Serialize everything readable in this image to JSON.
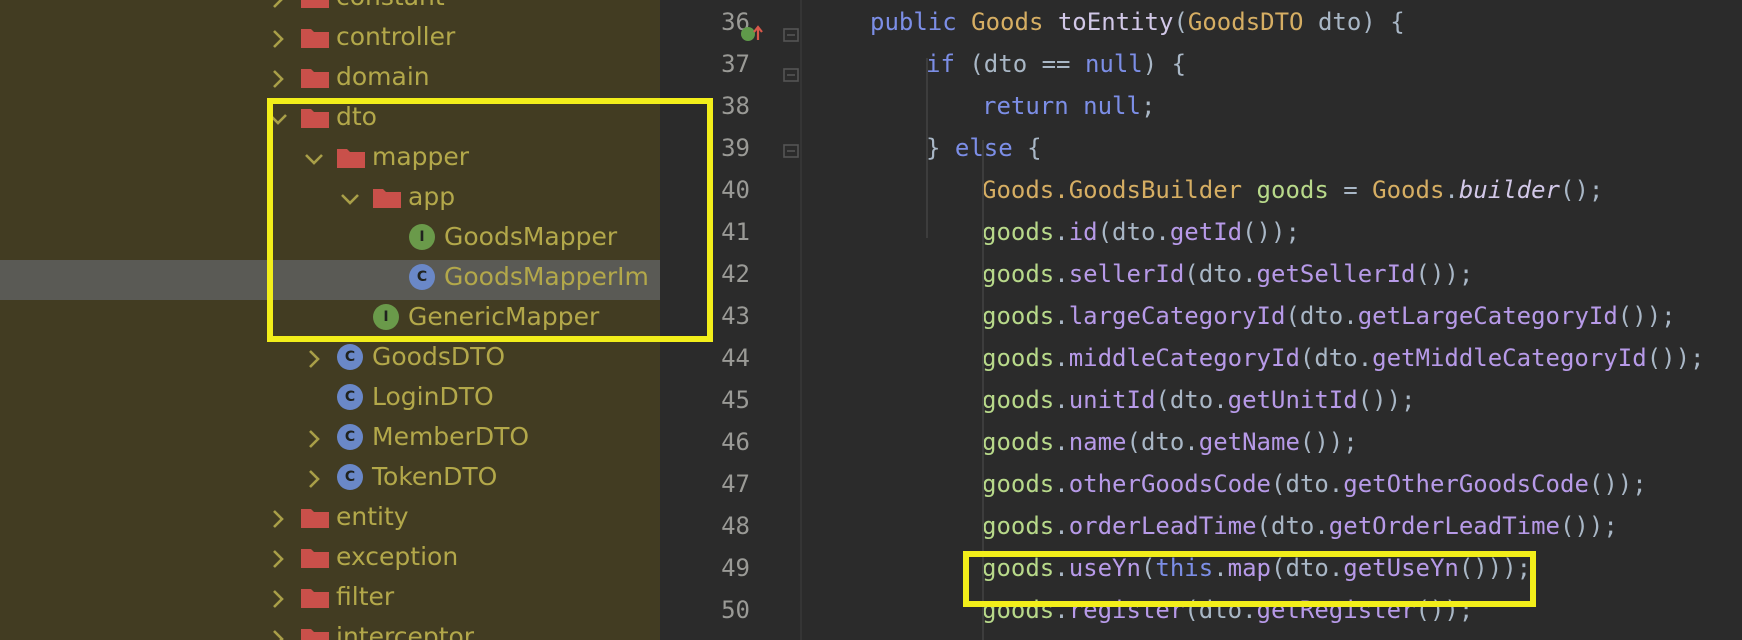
{
  "project_tree": {
    "items": [
      {
        "label": "constant",
        "type": "folder"
      },
      {
        "label": "controller",
        "type": "folder"
      },
      {
        "label": "domain",
        "type": "folder"
      },
      {
        "label": "dto",
        "type": "folder"
      },
      {
        "label": "mapper",
        "type": "folder"
      },
      {
        "label": "app",
        "type": "folder"
      },
      {
        "label": "GoodsMapper",
        "type": "interface",
        "badge": "I"
      },
      {
        "label": "GoodsMapperIm",
        "type": "class",
        "badge": "C"
      },
      {
        "label": "GenericMapper",
        "type": "interface",
        "badge": "I"
      },
      {
        "label": "GoodsDTO",
        "type": "class",
        "badge": "C"
      },
      {
        "label": "LoginDTO",
        "type": "class",
        "badge": "C"
      },
      {
        "label": "MemberDTO",
        "type": "class",
        "badge": "C"
      },
      {
        "label": "TokenDTO",
        "type": "class",
        "badge": "C"
      },
      {
        "label": "entity",
        "type": "folder"
      },
      {
        "label": "exception",
        "type": "folder"
      },
      {
        "label": "filter",
        "type": "folder"
      },
      {
        "label": "interceptor",
        "type": "folder"
      }
    ]
  },
  "editor": {
    "lines": [
      {
        "num": "36",
        "text": "public Goods toEntity(GoodsDTO dto) {"
      },
      {
        "num": "37",
        "text": "if (dto == null) {"
      },
      {
        "num": "38",
        "text": "return null;"
      },
      {
        "num": "39",
        "text": "} else {"
      },
      {
        "num": "40",
        "text": "Goods.GoodsBuilder goods = Goods.builder();"
      },
      {
        "num": "41",
        "text": "goods.id(dto.getId());"
      },
      {
        "num": "42",
        "text": "goods.sellerId(dto.getSellerId());"
      },
      {
        "num": "43",
        "text": "goods.largeCategoryId(dto.getLargeCategoryId());"
      },
      {
        "num": "44",
        "text": "goods.middleCategoryId(dto.getMiddleCategoryId());"
      },
      {
        "num": "45",
        "text": "goods.unitId(dto.getUnitId());"
      },
      {
        "num": "46",
        "text": "goods.name(dto.getName());"
      },
      {
        "num": "47",
        "text": "goods.otherGoodsCode(dto.getOtherGoodsCode());"
      },
      {
        "num": "48",
        "text": "goods.orderLeadTime(dto.getOrderLeadTime());"
      },
      {
        "num": "49",
        "text": "goods.useYn(this.map(dto.getUseYn()));"
      },
      {
        "num": "50",
        "text": "goods.register(dto.getRegister());"
      }
    ]
  },
  "colors": {
    "tree_bg": "#423c22",
    "tree_text": "#b3a84a",
    "folder": "#c9504a",
    "editor_bg": "#2b2b2b",
    "highlight": "#f2ee1a",
    "interface_badge": "#6a9a4a",
    "class_badge": "#6a88c8"
  }
}
